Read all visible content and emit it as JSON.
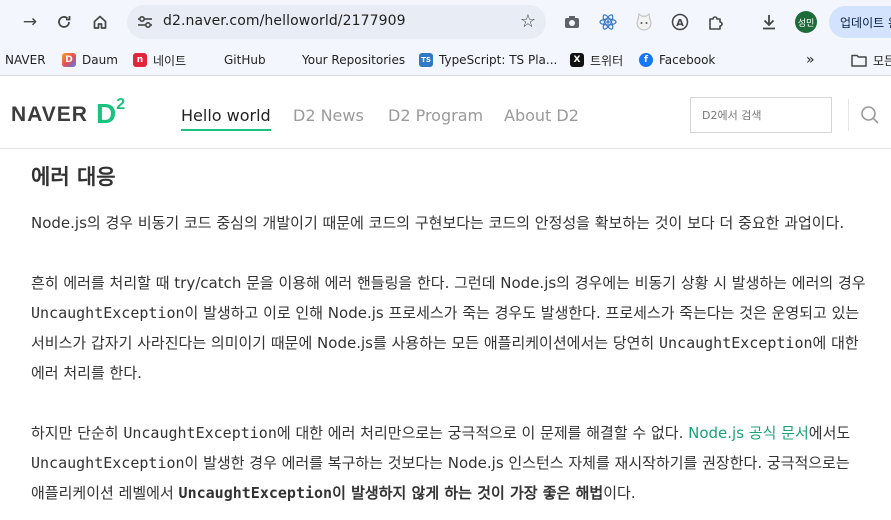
{
  "browser": {
    "url": "d2.naver.com/helloworld/2177909",
    "profile_initials": "성민",
    "update_label": "업데이트 완료",
    "extensions": [
      "camera-icon",
      "react-icon",
      "cat-icon",
      "a-icon",
      "puzzle-icon",
      "download-icon"
    ]
  },
  "bookmarks": [
    {
      "label": "NAVER",
      "icon": "none",
      "color": ""
    },
    {
      "label": "Daum",
      "icon": "D",
      "color": "#4a7cf7"
    },
    {
      "label": "네이트",
      "icon": "n",
      "color": "#e0263a"
    },
    {
      "label": "GitHub",
      "icon": "none",
      "color": ""
    },
    {
      "label": "Your Repositories",
      "icon": "none",
      "color": ""
    },
    {
      "label": "TypeScript: TS Pla...",
      "icon": "TS",
      "color": "#3178c6"
    },
    {
      "label": "트위터",
      "icon": "X",
      "color": "#111111"
    },
    {
      "label": "Facebook",
      "icon": "f",
      "color": "#1877f2"
    },
    {
      "label": "모든",
      "icon": "folder",
      "color": ""
    }
  ],
  "site": {
    "logo_text": "NAVER",
    "logo_mark": "D",
    "logo_sup": "2",
    "nav": [
      "Hello world",
      "D2 News",
      "D2 Program",
      "About D2"
    ],
    "search_placeholder": "D2에서 검색",
    "accent_color": "#19c37d"
  },
  "article": {
    "heading": "에러 대응",
    "p1": "Node.js의 경우 비동기 코드 중심의 개발이기 때문에 코드의 구현보다는 코드의 안정성을 확보하는 것이 보다 더 중요한 과업이다.",
    "p2_line1": "흔히 에러를 처리할 때 try/catch 문을 이용해 에러 핸들링을 한다. 그런데 Node.js의 경우에는 비동기 상황 시 발생하는 에러의 경우",
    "p2_line2_code": "UncaughtException",
    "p2_line2_rest": "이 발생하고 이로 인해 Node.js 프로세스가 죽는 경우도 발생한다. 프로세스가 죽는다는 것은 운영되고 있는",
    "p2_line3_pre": "서비스가 갑자기 사라진다는 의미이기 때문에 Node.js를 사용하는 모든 애플리케이션에서는 당연히 ",
    "p2_line3_code": "UncaughtException",
    "p2_line3_post": "에 대한",
    "p2_line4": "에러 처리를 한다.",
    "p3_line1_pre": "하지만 단순히 ",
    "p3_line1_code": "UncaughtException",
    "p3_line1_mid": "에 대한 에러 처리만으로는 궁극적으로 이 문제를 해결할 수 없다. ",
    "p3_link": "Node.js 공식 문서",
    "p3_line1_post": "에서도",
    "p3_line2_code": "UncaughtException",
    "p3_line2_rest": "이 발생한 경우 에러를 복구하는 것보다는 Node.js 인스턴스 자체를 재시작하기를 권장한다. 궁극적으로는",
    "p3_line3_pre": "애플리케이션 레벨에서 ",
    "p3_line3_code": "UncaughtException",
    "p3_line3_bold": "이 발생하지 않게 하는 것이 가장 좋은 해법",
    "p3_line3_post": "이다."
  }
}
